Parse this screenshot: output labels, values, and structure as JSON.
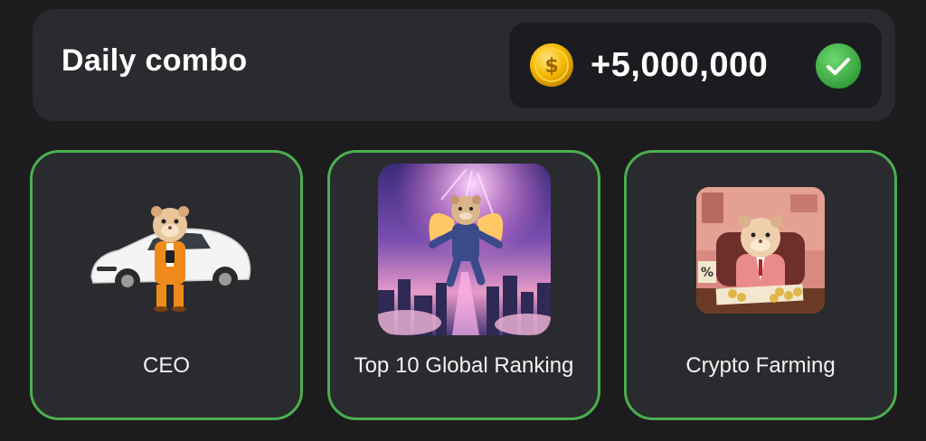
{
  "header": {
    "title": "Daily combo",
    "reward": "+5,000,000",
    "coin_icon": "coin-icon",
    "status_icon": "check-circle-icon",
    "coin_color": "#f5b800",
    "check_color": "#3cb043"
  },
  "cards": [
    {
      "label": "CEO",
      "image": "hamster-ceo-with-car",
      "selected": true
    },
    {
      "label": "Top 10 Global Ranking",
      "image": "hamster-flying-over-city",
      "selected": true
    },
    {
      "label": "Crypto Farming",
      "image": "hamster-at-desk-with-coins",
      "selected": true
    }
  ],
  "colors": {
    "background": "#1c1c1e",
    "panel": "#2a2b2f",
    "selected_border": "#4cae4f"
  }
}
